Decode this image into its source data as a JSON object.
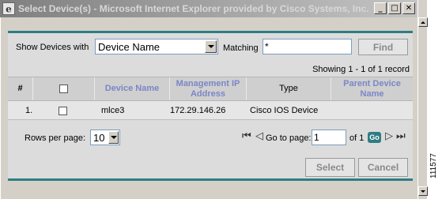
{
  "window": {
    "title": "Select Device(s) - Microsoft Internet Explorer provided by Cisco Systems, Inc.",
    "minimize_icon": "minimize-icon",
    "maximize_icon": "maximize-icon",
    "close_icon": "close-icon"
  },
  "filter": {
    "show_label": "Show Devices with",
    "field_selected": "Device Name",
    "matching_label": "Matching",
    "matching_value": "*",
    "find_label": "Find"
  },
  "showing_text": "Showing 1 - 1 of 1 record",
  "table": {
    "columns": [
      "#",
      "",
      "Device Name",
      "Management IP Address",
      "Type",
      "Parent Device Name"
    ],
    "rows": [
      {
        "index": "1.",
        "device_name": "mlce3",
        "ip": "172.29.146.26",
        "type": "Cisco IOS Device",
        "parent": ""
      }
    ]
  },
  "pager": {
    "rows_label": "Rows per page:",
    "rows_value": "10",
    "goto_label": "Go to page:",
    "page_value": "1",
    "of_label": "of 1",
    "go_label": "Go",
    "first_icon": "first-page-icon",
    "prev_icon": "prev-page-icon",
    "next_icon": "next-page-icon",
    "last_icon": "last-page-icon"
  },
  "actions": {
    "select_label": "Select",
    "cancel_label": "Cancel"
  },
  "side_code": "111577",
  "colors": {
    "accent_rule": "#2f7d82",
    "header_link": "#7b86c7",
    "window_gray": "#d4d0c8"
  }
}
